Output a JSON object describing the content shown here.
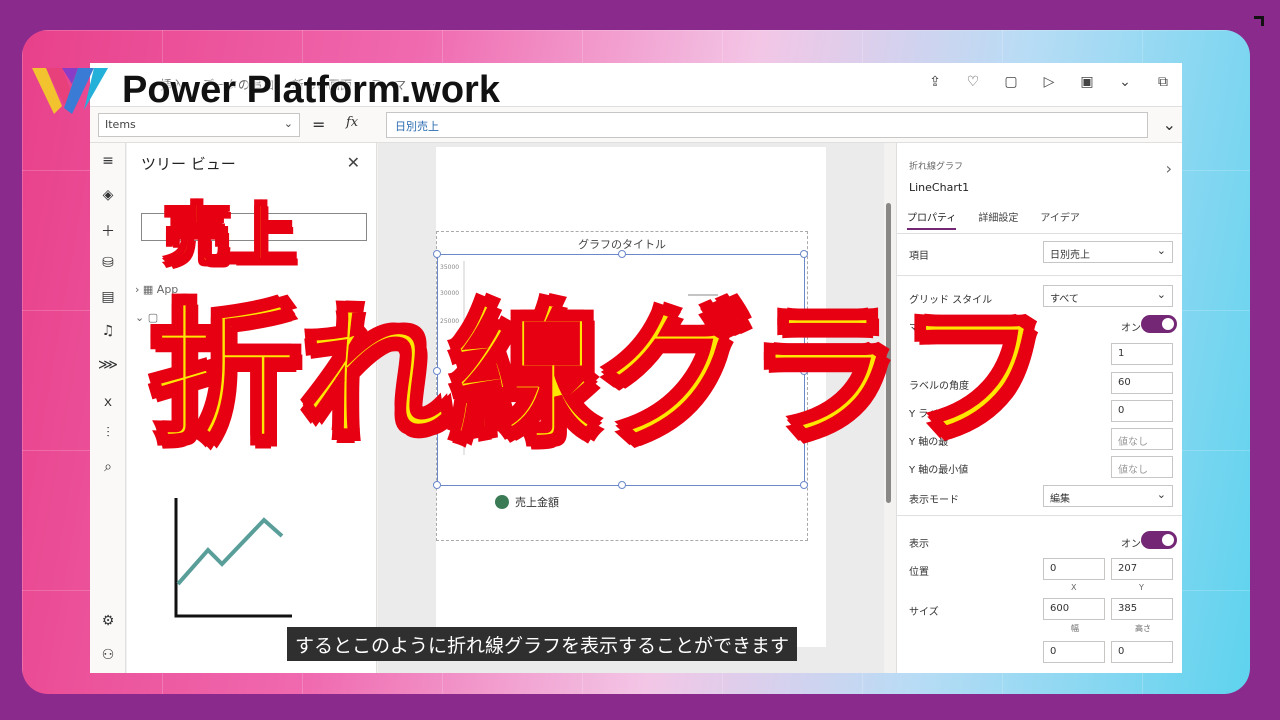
{
  "brand": {
    "name": "Power Platform.work",
    "logo_icon": "pp-logo-icon"
  },
  "overlay": {
    "title_small": "売上",
    "title_big": "折れ線グラフ",
    "subtitle": "するとこのように折れ線グラフを表示することができます"
  },
  "cmdbar": {
    "items": [
      "挿入",
      "データの追加",
      "新しい画面",
      "テーマ",
      "···"
    ],
    "right_icons": [
      "share-icon",
      "health-check-icon",
      "comment-icon",
      "play-icon",
      "save-icon",
      "chevron-down-icon",
      "publish-icon"
    ]
  },
  "formula": {
    "property": "Items",
    "equals": "=",
    "fx": "fx",
    "expression": "日別売上"
  },
  "tree": {
    "title": "ツリー ビュー",
    "rows": [
      "App",
      ""
    ]
  },
  "canvas": {
    "chart_title": "グラフのタイトル",
    "legend": "売上金額"
  },
  "chart_data": {
    "type": "line",
    "title": "グラフのタイトル",
    "series": [
      {
        "name": "売上金額",
        "values": []
      }
    ],
    "ytick_labels": [
      "35000",
      "30000",
      "25000"
    ]
  },
  "props": {
    "control_type": "折れ線グラフ",
    "control_name": "LineChart1",
    "tabs": [
      "プロパティ",
      "詳細設定",
      "アイデア"
    ],
    "rows": {
      "items_label": "項目",
      "items_value": "日別売上",
      "grid_style_label": "グリッド スタイル",
      "grid_style_value": "すべて",
      "markers_label": "マー",
      "markers_toggle": "オン",
      "number_value": "1",
      "label_angle_label": "ラベルの角度",
      "label_angle_value": "60",
      "y_label_label": "Y ラベル",
      "y_label_value": "0",
      "y_max_label": "Y 軸の最",
      "y_max_value": "値なし",
      "y_min_label": "Y 軸の最小値",
      "y_min_value": "値なし",
      "display_mode_label": "表示モード",
      "display_mode_value": "編集",
      "visible_label": "表示",
      "visible_toggle": "オン",
      "position_label": "位置",
      "position_x": "0",
      "position_y": "207",
      "x_caption": "X",
      "y_caption": "Y",
      "size_label": "サイズ",
      "size_w": "600",
      "size_h": "385",
      "w_caption": "幅",
      "h_caption": "高さ",
      "pad_a": "0",
      "pad_b": "0"
    }
  },
  "colors": {
    "accent": "#742774",
    "title_fill": "#ffe600",
    "title_stroke": "#e60012",
    "chart_line": "#5a9e9a",
    "legend_dot": "#3a7a55"
  }
}
